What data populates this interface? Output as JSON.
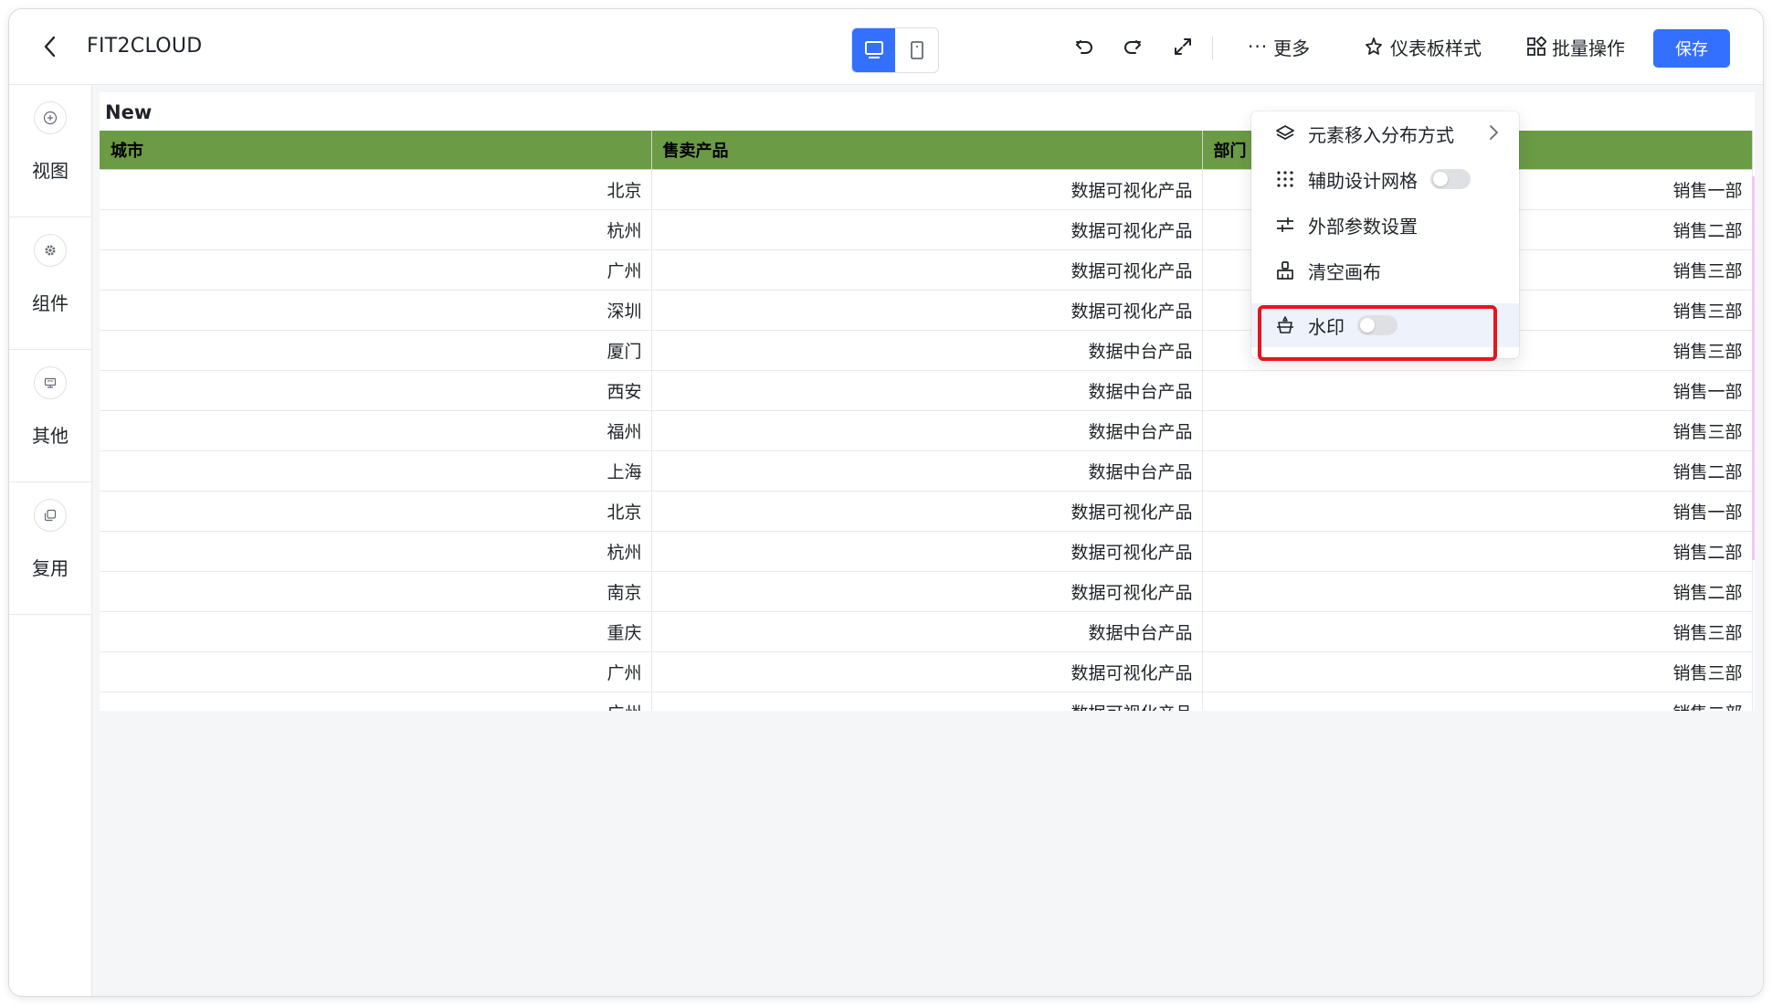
{
  "header": {
    "title": "FIT2CLOUD",
    "view_modes": [
      "pc",
      "mobile"
    ],
    "active_view": "pc",
    "more_label": "更多",
    "style_label": "仪表板样式",
    "batch_label": "批量操作",
    "save_label": "保存"
  },
  "sidebar": {
    "items": [
      {
        "label": "视图",
        "icon": "plus-circle-icon"
      },
      {
        "label": "组件",
        "icon": "gear-icon"
      },
      {
        "label": "其他",
        "icon": "media-icon"
      },
      {
        "label": "复用",
        "icon": "copy-icon"
      }
    ]
  },
  "table": {
    "title": "New",
    "header_color": "#6b9b45",
    "columns": [
      "城市",
      "售卖产品",
      "部门"
    ],
    "rows": [
      [
        "北京",
        "数据可视化产品",
        "销售一部"
      ],
      [
        "杭州",
        "数据可视化产品",
        "销售二部"
      ],
      [
        "广州",
        "数据可视化产品",
        "销售三部"
      ],
      [
        "深圳",
        "数据可视化产品",
        "销售三部"
      ],
      [
        "厦门",
        "数据中台产品",
        "销售三部"
      ],
      [
        "西安",
        "数据中台产品",
        "销售一部"
      ],
      [
        "福州",
        "数据中台产品",
        "销售三部"
      ],
      [
        "上海",
        "数据中台产品",
        "销售二部"
      ],
      [
        "北京",
        "数据可视化产品",
        "销售一部"
      ],
      [
        "杭州",
        "数据可视化产品",
        "销售二部"
      ],
      [
        "南京",
        "数据可视化产品",
        "销售二部"
      ],
      [
        "重庆",
        "数据中台产品",
        "销售三部"
      ],
      [
        "广州",
        "数据可视化产品",
        "销售三部"
      ],
      [
        "广州",
        "数据可视化产品",
        "销售二部"
      ]
    ]
  },
  "more_menu": {
    "items": [
      {
        "label": "元素移入分布方式",
        "icon": "layers-icon",
        "has_submenu": true
      },
      {
        "label": "辅助设计网格",
        "icon": "grid-dots-icon",
        "toggle": false
      },
      {
        "label": "外部参数设置",
        "icon": "sliders-icon"
      },
      {
        "label": "清空画布",
        "icon": "brush-icon"
      },
      {
        "label": "水印",
        "icon": "watermark-icon",
        "toggle": false
      }
    ]
  },
  "colors": {
    "accent": "#3370ff",
    "highlight_box": "#e8141c"
  }
}
